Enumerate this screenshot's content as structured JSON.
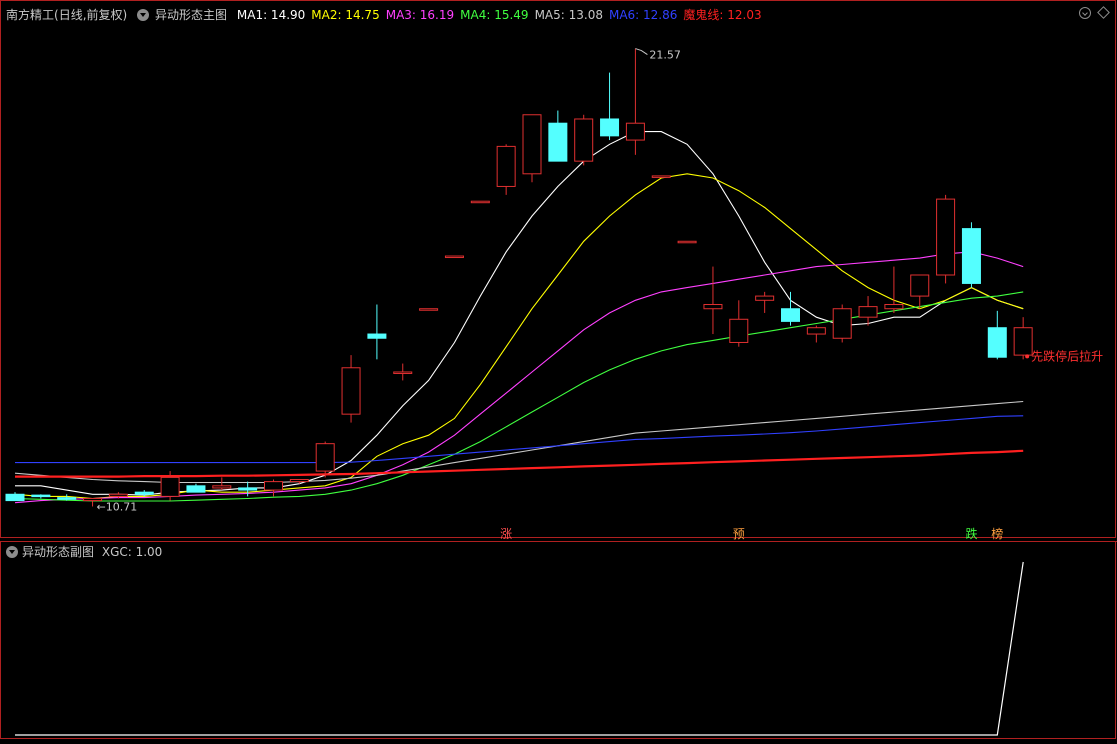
{
  "header": {
    "stock": "南方精工",
    "period": "(日线,前复权)",
    "indicator": "异动形态主图",
    "ma_items": [
      {
        "label": "MA1: 14.90",
        "color": "#ffffff"
      },
      {
        "label": "MA2: 14.75",
        "color": "#ffff00"
      },
      {
        "label": "MA3: 16.19",
        "color": "#ff40ff"
      },
      {
        "label": "MA4: 15.49",
        "color": "#40ff40"
      },
      {
        "label": "MA5: 13.08",
        "color": "#c8c8c8"
      },
      {
        "label": "MA6: 12.86",
        "color": "#3040ff"
      },
      {
        "label": "魔鬼线: 12.03",
        "color": "#ff2020"
      }
    ]
  },
  "sub_header": {
    "indicator": "异动形态副图",
    "value": "XGC: 1.00"
  },
  "colors": {
    "up": "#e03030",
    "down": "#54ffff",
    "ma1": "#ffffff",
    "ma2": "#ffff00",
    "ma3": "#ff40ff",
    "ma4": "#40ff40",
    "ma5": "#c8c8c8",
    "ma6": "#3040ff",
    "devil": "#ff2020",
    "frame": "#b02020"
  },
  "chart_data": [
    {
      "type": "candlestick",
      "x": [
        0,
        1,
        2,
        3,
        4,
        5,
        6,
        7,
        8,
        9,
        10,
        11,
        12,
        13,
        14,
        15,
        16,
        17,
        18,
        19,
        20,
        21,
        22,
        23,
        24,
        25,
        26,
        27,
        28,
        29,
        30,
        31,
        32,
        33,
        34,
        35,
        36,
        37,
        38,
        39
      ],
      "ohlc": [
        [
          11.0,
          11.05,
          10.9,
          10.85
        ],
        [
          10.98,
          11.0,
          10.9,
          10.96
        ],
        [
          10.92,
          11.0,
          10.85,
          10.88
        ],
        [
          10.85,
          10.9,
          10.71,
          10.9
        ],
        [
          10.95,
          11.05,
          10.9,
          11.0
        ],
        [
          11.05,
          11.1,
          10.95,
          11.0
        ],
        [
          10.95,
          11.55,
          10.85,
          11.4
        ],
        [
          11.2,
          11.25,
          11.05,
          11.05
        ],
        [
          11.15,
          11.4,
          11.1,
          11.2
        ],
        [
          11.15,
          11.3,
          10.95,
          11.1
        ],
        [
          11.1,
          11.35,
          10.95,
          11.3
        ],
        [
          11.3,
          11.35,
          11.25,
          11.35
        ],
        [
          11.55,
          12.25,
          11.4,
          12.2
        ],
        [
          12.9,
          14.3,
          12.7,
          14.0
        ],
        [
          14.8,
          15.5,
          14.2,
          14.7
        ],
        [
          13.9,
          14.1,
          13.7,
          13.9
        ],
        [
          15.4,
          15.4,
          15.4,
          15.4
        ],
        [
          16.65,
          16.65,
          16.65,
          16.65
        ],
        [
          17.95,
          17.95,
          17.95,
          17.95
        ],
        [
          18.3,
          19.3,
          18.1,
          19.25
        ],
        [
          18.6,
          20.0,
          18.4,
          20.0
        ],
        [
          19.8,
          20.1,
          18.9,
          18.9
        ],
        [
          18.9,
          20.0,
          18.8,
          19.9
        ],
        [
          19.9,
          21.0,
          19.4,
          19.5
        ],
        [
          19.4,
          21.57,
          19.05,
          19.8
        ],
        [
          18.55,
          18.55,
          18.55,
          18.55
        ],
        [
          17.0,
          17.0,
          17.0,
          17.0
        ],
        [
          15.4,
          16.4,
          14.8,
          15.5
        ],
        [
          14.6,
          15.6,
          14.5,
          15.15
        ],
        [
          15.6,
          15.8,
          15.3,
          15.7
        ],
        [
          15.4,
          15.8,
          15.0,
          15.1
        ],
        [
          14.8,
          15.0,
          14.6,
          14.95
        ],
        [
          14.7,
          15.5,
          14.6,
          15.4
        ],
        [
          15.2,
          15.7,
          15.0,
          15.45
        ],
        [
          15.4,
          16.4,
          15.3,
          15.5
        ],
        [
          15.7,
          16.2,
          15.4,
          16.2
        ],
        [
          16.2,
          18.1,
          16.0,
          18.0
        ],
        [
          17.3,
          17.45,
          15.9,
          16.0
        ],
        [
          14.95,
          15.35,
          14.2,
          14.25
        ],
        [
          14.3,
          15.2,
          14.2,
          14.95
        ]
      ],
      "ylim": [
        10.2,
        22.2
      ],
      "high_label": "21.57",
      "low_label": "10.71",
      "series": [
        {
          "key": "ma1",
          "values": [
            11.2,
            11.2,
            11.1,
            11.0,
            11.0,
            10.98,
            11.05,
            11.08,
            11.1,
            11.15,
            11.15,
            11.25,
            11.45,
            11.8,
            12.4,
            13.1,
            13.7,
            14.6,
            15.7,
            16.75,
            17.6,
            18.3,
            18.9,
            19.3,
            19.6,
            19.6,
            19.3,
            18.6,
            17.6,
            16.5,
            15.6,
            15.2,
            15.0,
            15.05,
            15.2,
            15.2,
            15.6,
            15.9,
            15.6,
            15.4
          ]
        },
        {
          "key": "ma2",
          "values": [
            11.0,
            10.95,
            10.95,
            10.9,
            10.95,
            10.95,
            11.0,
            11.1,
            11.05,
            11.05,
            11.1,
            11.15,
            11.2,
            11.4,
            11.9,
            12.2,
            12.4,
            12.8,
            13.6,
            14.5,
            15.4,
            16.2,
            17.0,
            17.6,
            18.1,
            18.5,
            18.6,
            18.5,
            18.2,
            17.8,
            17.3,
            16.8,
            16.3,
            15.9,
            15.6,
            15.4,
            15.6,
            15.9,
            15.6,
            15.4
          ]
        },
        {
          "key": "ma3",
          "values": [
            10.8,
            10.85,
            10.88,
            10.9,
            10.92,
            10.92,
            10.95,
            10.98,
            11.0,
            11.02,
            11.05,
            11.1,
            11.15,
            11.25,
            11.45,
            11.7,
            12.0,
            12.4,
            12.9,
            13.4,
            13.9,
            14.4,
            14.9,
            15.3,
            15.6,
            15.8,
            15.9,
            16.0,
            16.1,
            16.2,
            16.3,
            16.4,
            16.45,
            16.5,
            16.55,
            16.6,
            16.7,
            16.75,
            16.6,
            16.4
          ]
        },
        {
          "key": "ma4",
          "values": [
            10.9,
            10.88,
            10.86,
            10.84,
            10.84,
            10.84,
            10.84,
            10.86,
            10.88,
            10.9,
            10.93,
            10.95,
            11.0,
            11.1,
            11.25,
            11.45,
            11.7,
            11.95,
            12.25,
            12.6,
            12.95,
            13.3,
            13.65,
            13.95,
            14.2,
            14.4,
            14.55,
            14.65,
            14.75,
            14.85,
            14.95,
            15.05,
            15.15,
            15.25,
            15.35,
            15.45,
            15.55,
            15.65,
            15.7,
            15.8
          ]
        },
        {
          "key": "ma5",
          "values": [
            11.5,
            11.45,
            11.4,
            11.35,
            11.32,
            11.3,
            11.28,
            11.28,
            11.28,
            11.28,
            11.28,
            11.3,
            11.33,
            11.38,
            11.45,
            11.55,
            11.65,
            11.75,
            11.85,
            11.95,
            12.05,
            12.15,
            12.25,
            12.35,
            12.45,
            12.5,
            12.55,
            12.6,
            12.65,
            12.7,
            12.75,
            12.8,
            12.85,
            12.9,
            12.95,
            13.0,
            13.05,
            13.1,
            13.15,
            13.2
          ]
        },
        {
          "key": "ma6",
          "values": [
            11.75,
            11.75,
            11.75,
            11.75,
            11.75,
            11.75,
            11.75,
            11.75,
            11.75,
            11.75,
            11.75,
            11.75,
            11.75,
            11.76,
            11.8,
            11.85,
            11.9,
            11.95,
            12.0,
            12.05,
            12.1,
            12.15,
            12.2,
            12.25,
            12.3,
            12.32,
            12.35,
            12.38,
            12.4,
            12.43,
            12.46,
            12.5,
            12.55,
            12.6,
            12.65,
            12.7,
            12.75,
            12.8,
            12.85,
            12.86
          ]
        },
        {
          "key": "devil",
          "values": [
            11.42,
            11.42,
            11.42,
            11.42,
            11.42,
            11.43,
            11.43,
            11.43,
            11.44,
            11.44,
            11.45,
            11.46,
            11.47,
            11.48,
            11.5,
            11.52,
            11.54,
            11.56,
            11.58,
            11.6,
            11.62,
            11.64,
            11.66,
            11.68,
            11.7,
            11.72,
            11.74,
            11.76,
            11.78,
            11.8,
            11.82,
            11.84,
            11.86,
            11.88,
            11.9,
            11.92,
            11.95,
            11.98,
            12.0,
            12.03
          ]
        }
      ],
      "markers": [
        {
          "x": 19,
          "label": "涨",
          "color": "#ff5050"
        },
        {
          "x": 28,
          "label": "预",
          "color": "#ffa040"
        },
        {
          "x": 37,
          "label": "跌",
          "color": "#40ff40"
        },
        {
          "x": 38,
          "label": "榜",
          "color": "#ffa040"
        }
      ],
      "annotation": {
        "x": 39,
        "y": 14.2,
        "text": "先跌停后拉升",
        "color": "#ff3030"
      }
    },
    {
      "type": "line",
      "name": "XGC",
      "x": [
        0,
        1,
        2,
        3,
        4,
        5,
        6,
        7,
        8,
        9,
        10,
        11,
        12,
        13,
        14,
        15,
        16,
        17,
        18,
        19,
        20,
        21,
        22,
        23,
        24,
        25,
        26,
        27,
        28,
        29,
        30,
        31,
        32,
        33,
        34,
        35,
        36,
        37,
        38,
        39
      ],
      "values": [
        0,
        0,
        0,
        0,
        0,
        0,
        0,
        0,
        0,
        0,
        0,
        0,
        0,
        0,
        0,
        0,
        0,
        0,
        0,
        0,
        0,
        0,
        0,
        0,
        0,
        0,
        0,
        0,
        0,
        0,
        0,
        0,
        0,
        0,
        0,
        0,
        0,
        0,
        0,
        1
      ],
      "ylim": [
        0,
        1
      ]
    }
  ]
}
